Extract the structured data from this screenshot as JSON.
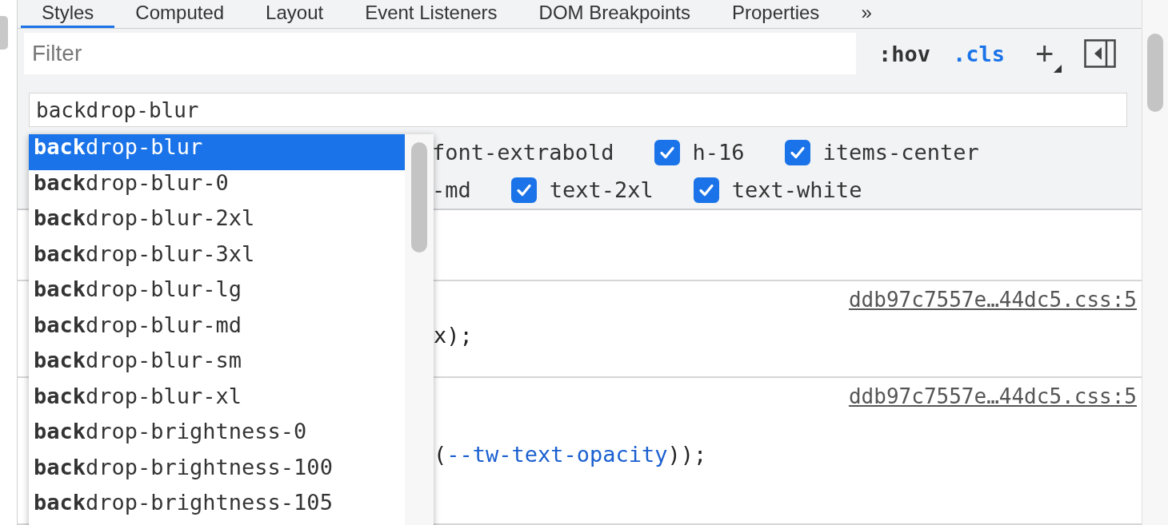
{
  "tabs": [
    {
      "label": "Styles",
      "selected": true
    },
    {
      "label": "Computed",
      "selected": false
    },
    {
      "label": "Layout",
      "selected": false
    },
    {
      "label": "Event Listeners",
      "selected": false
    },
    {
      "label": "DOM Breakpoints",
      "selected": false
    },
    {
      "label": "Properties",
      "selected": false
    },
    {
      "label": "»",
      "selected": false
    }
  ],
  "toolbar": {
    "filter": {
      "placeholder": "Filter"
    },
    "hov": ":hov",
    "cls": ".cls",
    "add": "+"
  },
  "class_input": {
    "value": "backdrop-blur"
  },
  "class_toggles": [
    [
      {
        "label": "font-extrabold",
        "kind": "fragment"
      },
      {
        "label": "h-16",
        "kind": "toggle",
        "checked": true
      },
      {
        "label": "items-center",
        "kind": "toggle",
        "checked": true
      }
    ],
    [
      {
        "label": "-md",
        "kind": "fragment"
      },
      {
        "label": "text-2xl",
        "kind": "toggle",
        "checked": true
      },
      {
        "label": "text-white",
        "kind": "toggle",
        "checked": true
      }
    ]
  ],
  "rules": [
    {
      "source": "ddb97c7557e…44dc5.css:5",
      "lines": [
        [
          {
            "text": "x);",
            "kind": "plain"
          }
        ]
      ]
    },
    {
      "source": "ddb97c7557e…44dc5.css:5",
      "lines": [
        [
          {
            "text": "(",
            "kind": "plain"
          },
          {
            "text": "--tw-text-opacity",
            "kind": "variable"
          },
          {
            "text": "));",
            "kind": "plain"
          }
        ]
      ]
    }
  ],
  "autocomplete": [
    {
      "text": "**back**drop-blur",
      "selected": true
    },
    {
      "text": "**back**drop-blur-0",
      "selected": false
    },
    {
      "text": "**back**drop-blur-2xl",
      "selected": false
    },
    {
      "text": "**back**drop-blur-3xl",
      "selected": false
    },
    {
      "text": "**back**drop-blur-lg",
      "selected": false
    },
    {
      "text": "**back**drop-blur-md",
      "selected": false
    },
    {
      "text": "**back**drop-blur-sm",
      "selected": false
    },
    {
      "text": "**back**drop-blur-xl",
      "selected": false
    },
    {
      "text": "**back**drop-brightness-0",
      "selected": false
    },
    {
      "text": "**back**drop-brightness-100",
      "selected": false
    },
    {
      "text": "**back**drop-brightness-105",
      "selected": false
    }
  ]
}
